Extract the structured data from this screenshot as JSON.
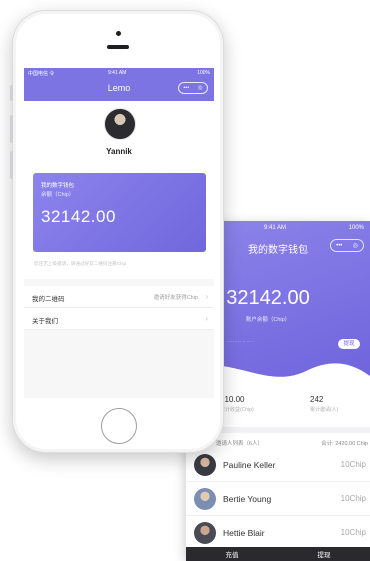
{
  "front": {
    "status": {
      "left": "中国电信 令",
      "center": "9:41 AM",
      "right": "100%"
    },
    "nav": {
      "title": "Lemo",
      "pill_left": "•••",
      "pill_right": "◎"
    },
    "profile": {
      "name": "Yannik"
    },
    "card": {
      "title": "我的数字钱包",
      "subtitle": "余额（Chip）",
      "amount": "32142.00",
      "hint": "您还无上级邀请，请通过好友二维码注册Chip"
    },
    "menu": [
      {
        "label": "我的二维码",
        "value": "邀请好友获得Chip"
      },
      {
        "label": "关于我们",
        "value": ""
      }
    ]
  },
  "back": {
    "status": {
      "left": "令",
      "center": "9:41 AM",
      "right": "100%"
    },
    "title": "我的数字钱包",
    "pill_left": "•••",
    "pill_right": "◎",
    "amount": "32142.00",
    "amount_label": "账户余额（Chip）",
    "faint_text": "········· ·· ·· ·",
    "withdraw_button": "提现",
    "stats": [
      {
        "value": "210.00",
        "label": "累计收益(Chip)"
      },
      {
        "value": "242",
        "label": "累计邀请(人)"
      }
    ],
    "list_header_left": "邀请人列表（6人）",
    "list_header_right": "合计: 2420.00 Chip",
    "invitees": [
      {
        "name": "Pauline Keller",
        "chips": "10Chip"
      },
      {
        "name": "Bertie Young",
        "chips": "10Chip"
      },
      {
        "name": "Hettie Blair",
        "chips": "10Chip"
      }
    ],
    "tabs": [
      "充值",
      "提现"
    ]
  },
  "colors": {
    "accent": "#7d74e4",
    "tabbar": "#2a2a2e"
  },
  "icons": {
    "chevron": "chevron-right-icon",
    "more": "more-icon",
    "target": "target-icon"
  }
}
